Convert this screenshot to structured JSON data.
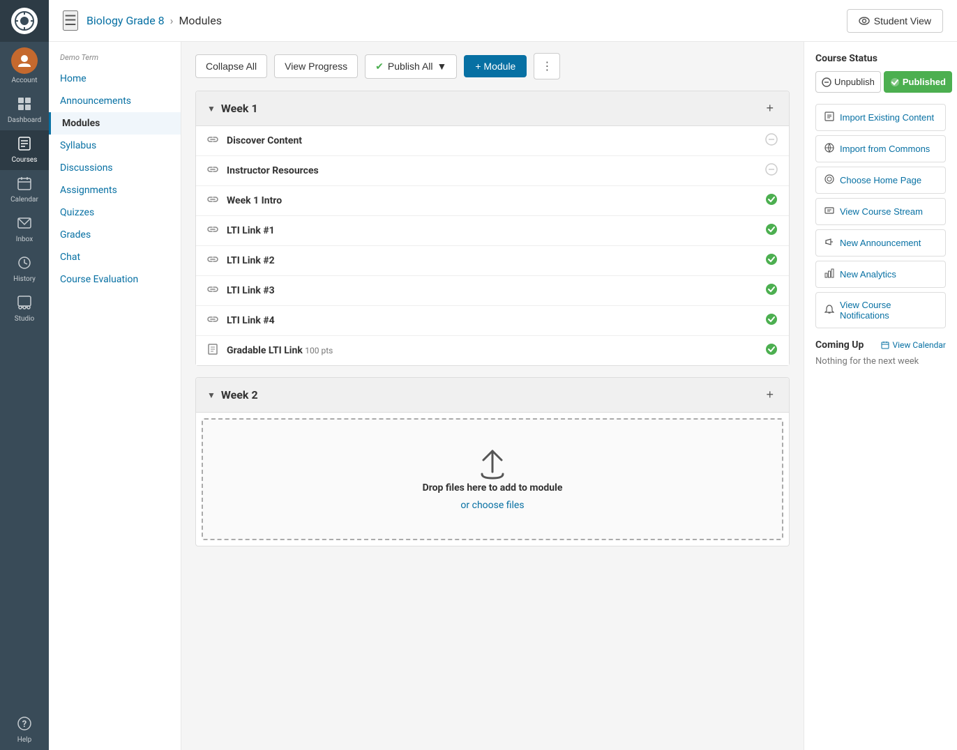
{
  "app": {
    "logo_alt": "Canvas Logo"
  },
  "left_nav": {
    "items": [
      {
        "id": "account",
        "label": "Account",
        "icon": "👤",
        "active": false
      },
      {
        "id": "dashboard",
        "label": "Dashboard",
        "icon": "📊",
        "active": false
      },
      {
        "id": "courses",
        "label": "Courses",
        "icon": "📖",
        "active": true
      },
      {
        "id": "calendar",
        "label": "Calendar",
        "icon": "📅",
        "active": false
      },
      {
        "id": "inbox",
        "label": "Inbox",
        "icon": "📥",
        "active": false
      },
      {
        "id": "history",
        "label": "History",
        "icon": "🕐",
        "active": false
      },
      {
        "id": "studio",
        "label": "Studio",
        "icon": "🎬",
        "active": false
      },
      {
        "id": "help",
        "label": "Help",
        "icon": "❓",
        "active": false
      }
    ]
  },
  "top_bar": {
    "hamburger_label": "☰",
    "breadcrumb_course": "Biology Grade 8",
    "breadcrumb_sep": "›",
    "breadcrumb_current": "Modules",
    "student_view_label": "Student View",
    "student_view_icon": "👁"
  },
  "sidebar": {
    "demo_term": "Demo Term",
    "links": [
      {
        "id": "home",
        "label": "Home",
        "active": false
      },
      {
        "id": "announcements",
        "label": "Announcements",
        "active": false
      },
      {
        "id": "modules",
        "label": "Modules",
        "active": true
      },
      {
        "id": "syllabus",
        "label": "Syllabus",
        "active": false
      },
      {
        "id": "discussions",
        "label": "Discussions",
        "active": false
      },
      {
        "id": "assignments",
        "label": "Assignments",
        "active": false
      },
      {
        "id": "quizzes",
        "label": "Quizzes",
        "active": false
      },
      {
        "id": "grades",
        "label": "Grades",
        "active": false
      },
      {
        "id": "chat",
        "label": "Chat",
        "active": false
      },
      {
        "id": "course_evaluation",
        "label": "Course Evaluation",
        "active": false
      }
    ]
  },
  "toolbar": {
    "collapse_all": "Collapse All",
    "view_progress": "View Progress",
    "publish_all": "Publish All",
    "add_module": "+ Module",
    "more_icon": "⋮"
  },
  "modules": [
    {
      "id": "week1",
      "title": "Week 1",
      "items": [
        {
          "id": "discover",
          "title": "Discover Content",
          "icon": "🔗",
          "status": "unpublished",
          "subtitle": ""
        },
        {
          "id": "instructor",
          "title": "Instructor Resources",
          "icon": "🔗",
          "status": "unpublished",
          "subtitle": ""
        },
        {
          "id": "week1intro",
          "title": "Week 1 Intro",
          "icon": "🔗",
          "status": "published",
          "subtitle": ""
        },
        {
          "id": "lti1",
          "title": "LTI Link #1",
          "icon": "🔗",
          "status": "published",
          "subtitle": ""
        },
        {
          "id": "lti2",
          "title": "LTI Link #2",
          "icon": "🔗",
          "status": "published",
          "subtitle": ""
        },
        {
          "id": "lti3",
          "title": "LTI Link #3",
          "icon": "🔗",
          "status": "published",
          "subtitle": ""
        },
        {
          "id": "lti4",
          "title": "LTI Link #4",
          "icon": "🔗",
          "status": "published",
          "subtitle": ""
        },
        {
          "id": "gradable",
          "title": "Gradable LTI Link",
          "icon": "📝",
          "status": "published",
          "subtitle": "100 pts"
        }
      ]
    },
    {
      "id": "week2",
      "title": "Week 2",
      "items": []
    }
  ],
  "drop_zone": {
    "text": "Drop files here to add to module",
    "link": "or choose files"
  },
  "right_panel": {
    "course_status_title": "Course Status",
    "unpublish_label": "Unpublish",
    "published_label": "Published",
    "actions": [
      {
        "id": "import_content",
        "label": "Import Existing Content",
        "icon": "📋"
      },
      {
        "id": "import_commons",
        "label": "Import from Commons",
        "icon": "⚙"
      },
      {
        "id": "choose_home",
        "label": "Choose Home Page",
        "icon": "⚙"
      },
      {
        "id": "view_stream",
        "label": "View Course Stream",
        "icon": "📊"
      },
      {
        "id": "new_announcement",
        "label": "New Announcement",
        "icon": "📢"
      },
      {
        "id": "new_analytics",
        "label": "New Analytics",
        "icon": "📊"
      },
      {
        "id": "view_notifications",
        "label": "View Course Notifications",
        "icon": "🔔"
      }
    ],
    "coming_up_title": "Coming Up",
    "view_calendar_label": "View Calendar",
    "view_calendar_icon": "📅",
    "coming_up_empty": "Nothing for the next week"
  }
}
